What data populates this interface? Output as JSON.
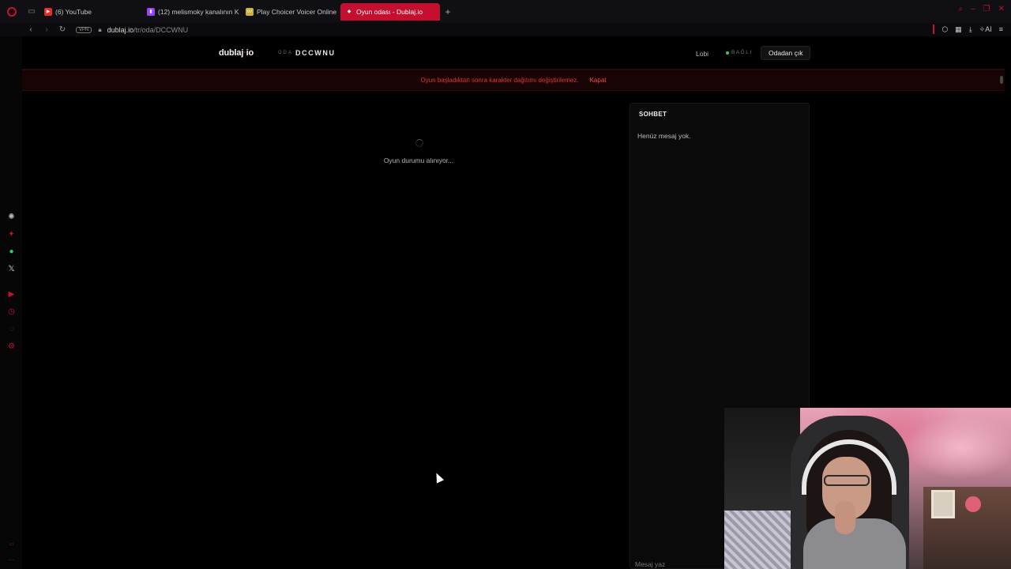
{
  "browser": {
    "tabs": [
      {
        "label": "(6) YouTube",
        "fav_color": "#e52d27",
        "fav_glyph": "▶"
      },
      {
        "label": "(12) melismoky kanalının K",
        "fav_color": "#9146ff",
        "fav_glyph": "▮"
      },
      {
        "label": "Play Choicer Voicer Online",
        "fav_color": "#c9b13a",
        "fav_glyph": "cv"
      },
      {
        "label": "Oyun odası - Dublaj.io",
        "fav_color": "#ffffff",
        "fav_glyph": "◆",
        "active": true
      }
    ],
    "new_tab": "+",
    "address": {
      "vpn": "VPN",
      "host": "dublaj.io",
      "path": "/tr/oda/DCCWNU"
    },
    "ai_label": "AI",
    "accent": "#c40f2e"
  },
  "sidebar_icons": [
    {
      "name": "chatgpt-icon",
      "glyph": "✺",
      "color": "#bbbbbb"
    },
    {
      "name": "aria-icon",
      "glyph": "✦",
      "color": "#c4122f"
    },
    {
      "name": "whatsapp-icon",
      "glyph": "●",
      "color": "#25d366"
    },
    {
      "name": "x-twitter-icon",
      "glyph": "𝕏",
      "color": "#dddddd"
    },
    {
      "name": "player-icon",
      "glyph": "▶",
      "color": "#c4122f"
    },
    {
      "name": "history-icon",
      "glyph": "◷",
      "color": "#c4122f"
    },
    {
      "name": "messages-icon",
      "glyph": "◌",
      "color": "#c4122f"
    },
    {
      "name": "settings-icon",
      "glyph": "⚙",
      "color": "#c4122f"
    }
  ],
  "header": {
    "logo_text": "dublaj",
    "logo_dot": "·",
    "logo_suffix": "io",
    "room_label": "ODA",
    "room_code": "DCCWNU",
    "lobby": "Lobi",
    "status": "BAĞLI",
    "leave": "Odadan çık"
  },
  "warning": {
    "text": "Oyun başladıktan sonra karakter dağıtımı değiştirilemez.",
    "close": "Kapat"
  },
  "game": {
    "loading": "Oyun durumu alınıyor..."
  },
  "chat": {
    "title": "SOHBET",
    "empty": "Henüz mesaj yok.",
    "placeholder": "Mesaj yaz"
  }
}
